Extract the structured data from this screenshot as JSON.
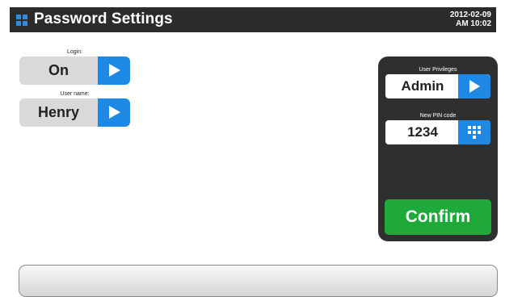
{
  "header": {
    "title": "Password Settings",
    "date": "2012-02-09",
    "time": "AM 10:02"
  },
  "login": {
    "label": "Login:",
    "value": "On"
  },
  "username": {
    "label": "User name:",
    "value": "Henry"
  },
  "panel": {
    "privileges_label": "User Privileges",
    "privileges_value": "Admin",
    "pin_label": "New PIN code",
    "pin_value": "1234",
    "confirm_label": "Confirm"
  },
  "icons": {
    "menu": "grid-icon",
    "arrow": "play-arrow-icon",
    "keypad": "keypad-icon"
  },
  "colors": {
    "header_bg": "#2b2b2b",
    "accent_blue": "#1e88e5",
    "confirm_green": "#1fa93b",
    "panel_bg": "#2f2f2f",
    "selector_bg": "#d9d9d9"
  }
}
